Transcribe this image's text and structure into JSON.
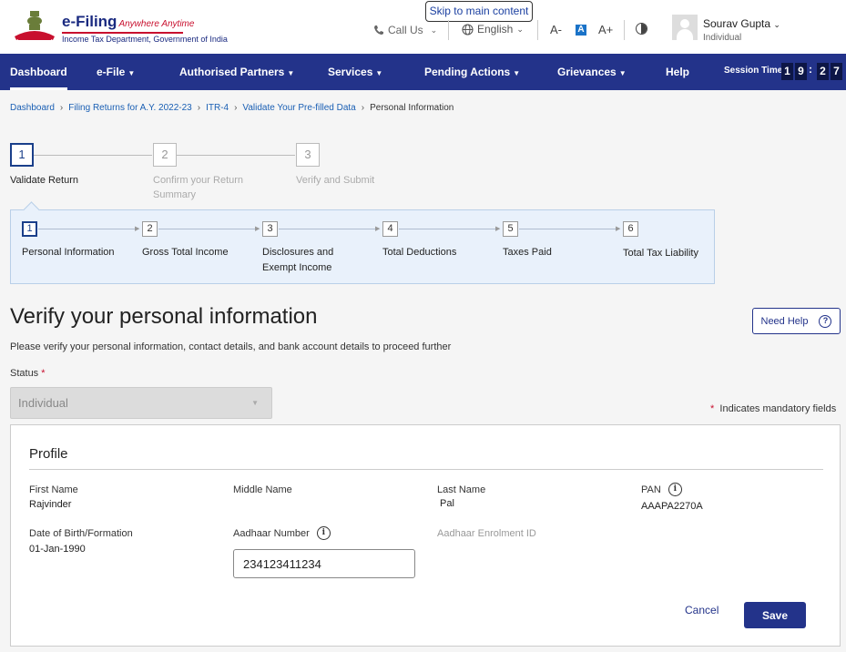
{
  "header": {
    "brand_title": "e-Filing",
    "brand_tagline": "Anywhere Anytime",
    "brand_subtitle": "Income Tax Department, Government of India",
    "skip_link": "Skip to main content",
    "call_us": "Call Us",
    "language": "English",
    "font_decrease": "A-",
    "font_default": "A",
    "font_increase": "A+",
    "user_name": "Sourav Gupta",
    "user_role": "Individual"
  },
  "nav": {
    "items": [
      {
        "label": "Dashboard"
      },
      {
        "label": "e-File"
      },
      {
        "label": "Authorised Partners"
      },
      {
        "label": "Services"
      },
      {
        "label": "Pending Actions"
      },
      {
        "label": "Grievances"
      },
      {
        "label": "Help"
      }
    ],
    "session_label": "Session Time",
    "session_digits": [
      "1",
      "9",
      "2",
      "7"
    ]
  },
  "breadcrumb": [
    "Dashboard",
    "Filing Returns for A.Y. 2022-23",
    "ITR-4",
    "Validate Your Pre-filled Data",
    "Personal Information"
  ],
  "main_steps": [
    {
      "num": "1",
      "label": "Validate Return"
    },
    {
      "num": "2",
      "label": "Confirm your Return Summary"
    },
    {
      "num": "3",
      "label": "Verify and Submit"
    }
  ],
  "sub_steps": [
    {
      "num": "1",
      "label": "Personal Information"
    },
    {
      "num": "2",
      "label": "Gross Total Income"
    },
    {
      "num": "3",
      "label": "Disclosures and Exempt Income"
    },
    {
      "num": "4",
      "label": "Total Deductions"
    },
    {
      "num": "5",
      "label": "Taxes Paid"
    },
    {
      "num": "6",
      "label": "Total Tax Liability"
    }
  ],
  "page": {
    "title": "Verify your personal information",
    "subtitle": "Please verify your personal information, contact details, and bank account details to proceed further",
    "need_help": "Need Help",
    "status_label": "Status",
    "status_value": "Individual",
    "mandatory_note": "Indicates mandatory fields"
  },
  "profile": {
    "title": "Profile",
    "first_name_label": "First Name",
    "first_name": "Rajvinder",
    "middle_name_label": "Middle Name",
    "last_name_label": "Last Name",
    "last_name": "Pal",
    "pan_label": "PAN",
    "pan": "AAAPA2270A",
    "dob_label": "Date of Birth/Formation",
    "dob": "01-Jan-1990",
    "aadhaar_label": "Aadhaar Number",
    "aadhaar": "234123411234",
    "enrolment_label": "Aadhaar Enrolment ID",
    "cancel": "Cancel",
    "save": "Save"
  }
}
